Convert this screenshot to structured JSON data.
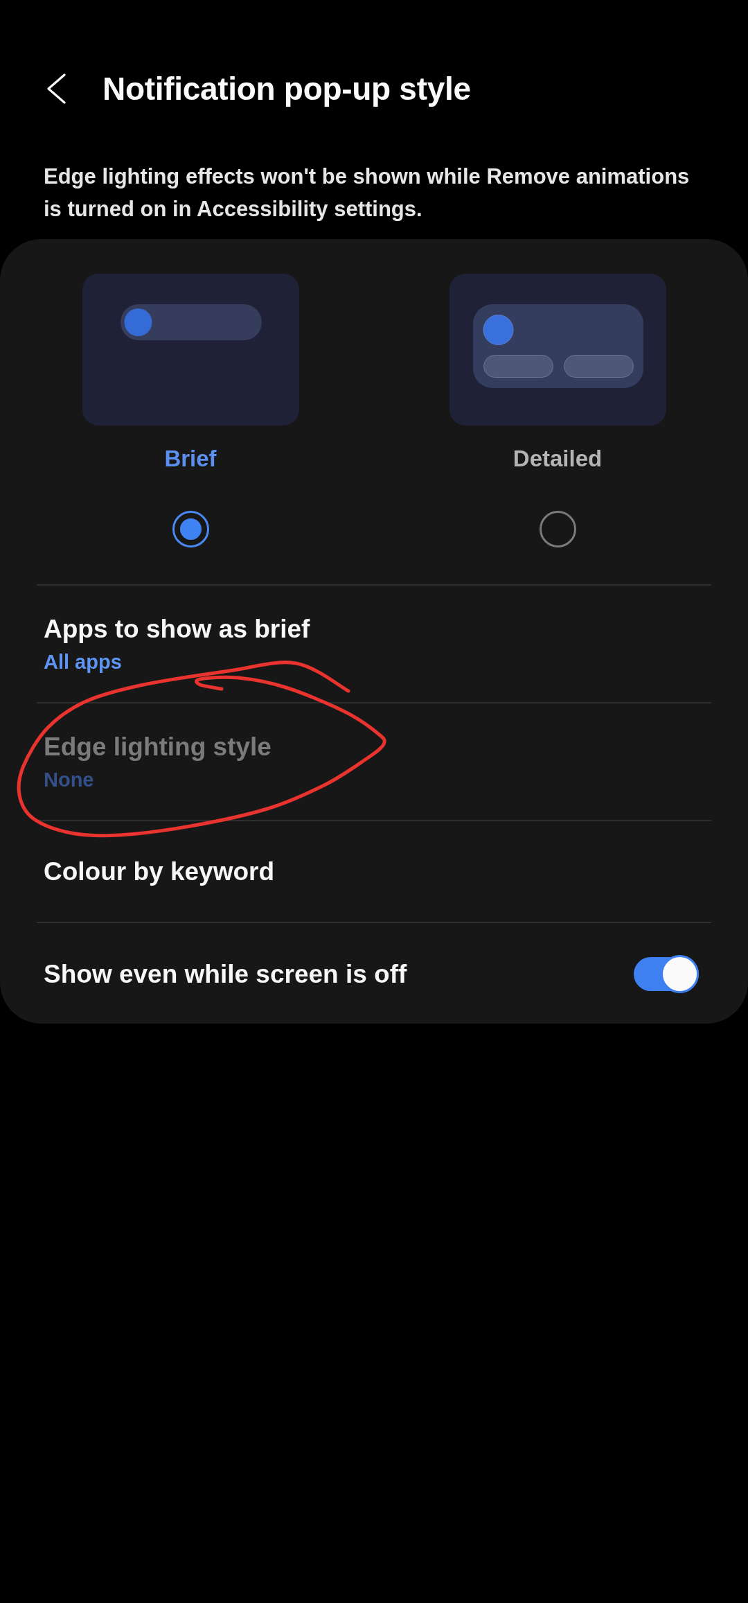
{
  "header": {
    "title": "Notification pop-up style"
  },
  "notice": "Edge lighting effects won't be shown while Remove animations is turned on in Accessibility settings.",
  "styles": [
    {
      "kind": "brief",
      "label": "Brief",
      "selected": true
    },
    {
      "kind": "detailed",
      "label": "Detailed",
      "selected": false
    }
  ],
  "settings": [
    {
      "kind": "link",
      "title": "Apps to show as brief",
      "summary": "All apps",
      "disabled": false,
      "circled": false
    },
    {
      "kind": "link",
      "title": "Edge lighting style",
      "summary": "None",
      "disabled": true,
      "circled": true
    },
    {
      "kind": "link",
      "title": "Colour by keyword",
      "disabled": false,
      "circled": false
    },
    {
      "kind": "switch",
      "title": "Show even while screen is off",
      "on": true,
      "disabled": false,
      "circled": false
    }
  ]
}
